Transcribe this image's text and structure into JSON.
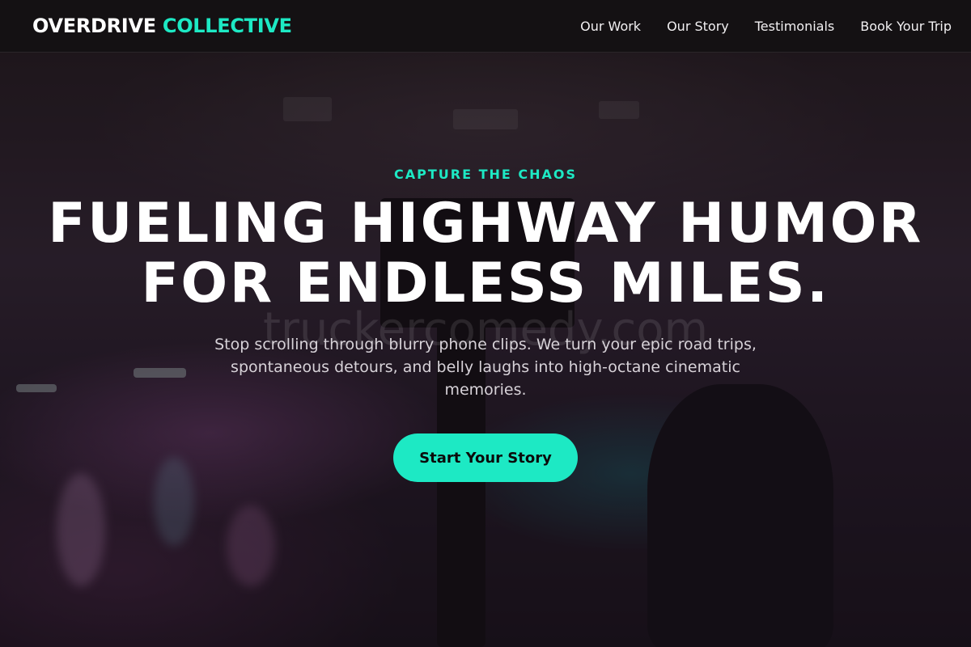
{
  "navbar": {
    "brand_part1": "OVERDRIVE",
    "brand_part2": "COLLECTIVE",
    "links": [
      "Our Work",
      "Our Story",
      "Testimonials",
      "Book Your Trip"
    ]
  },
  "hero": {
    "eyebrow": "CAPTURE THE CHAOS",
    "headline_line1": "FUELING HIGHWAY HUMOR",
    "headline_line2": "FOR ENDLESS MILES.",
    "subtitle": "Stop scrolling through blurry phone clips. We turn your epic road trips, spontaneous detours, and belly laughs into high-octane cinematic memories.",
    "cta_label": "Start Your Story",
    "watermark": "truckercomedy.com"
  },
  "colors": {
    "accent": "#1de9c4",
    "navbar_bg": "#141113",
    "text_primary": "#ffffff"
  }
}
